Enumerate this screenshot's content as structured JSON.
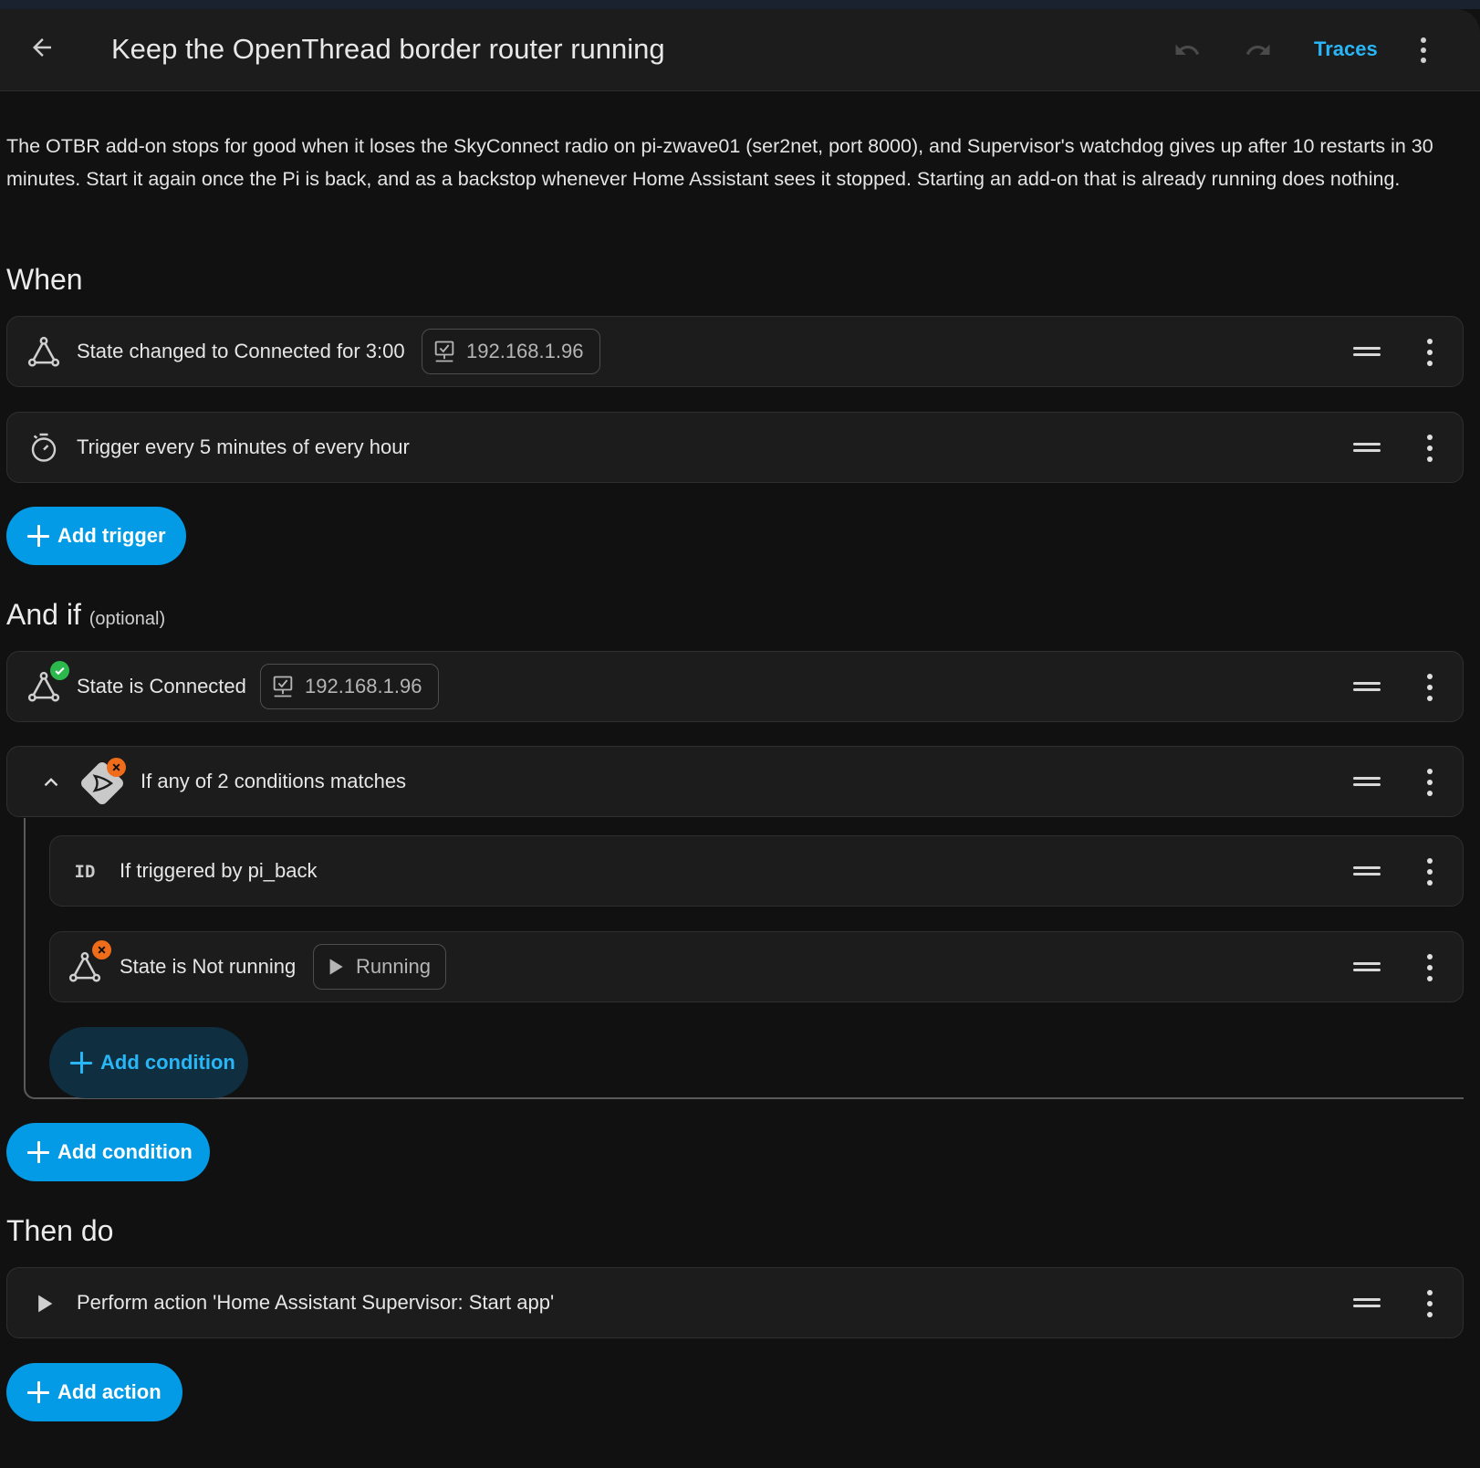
{
  "header": {
    "title": "Keep the OpenThread border router running",
    "traces_label": "Traces"
  },
  "description": "The OTBR add-on stops for good when it loses the SkyConnect radio on pi-zwave01 (ser2net, port 8000), and Supervisor's watchdog gives up after 10 restarts in 30 minutes. Start it again once the Pi is back, and as a backstop whenever Home Assistant sees it stopped. Starting an add-on that is already running does nothing.",
  "when": {
    "title": "When",
    "triggers": [
      {
        "label": "State changed to Connected for 3:00",
        "icon": "state-icon",
        "chip": "192.168.1.96",
        "chip_icon": "network-monitor-icon"
      },
      {
        "label": "Trigger every 5 minutes of every hour",
        "icon": "timer-icon"
      }
    ],
    "add_label": "Add trigger"
  },
  "and_if": {
    "title": "And if",
    "optional": "(optional)",
    "conditions": [
      {
        "label": "State is Connected",
        "icon": "state-icon",
        "badge": "check",
        "chip": "192.168.1.96",
        "chip_icon": "network-monitor-icon"
      },
      {
        "label": "If any of 2 conditions matches",
        "icon": "or-gate-icon",
        "badge": "error",
        "expanded": true,
        "children": [
          {
            "label": "If triggered by pi_back",
            "icon": "id-icon"
          },
          {
            "label": "State is Not running",
            "icon": "state-icon",
            "badge": "error",
            "chip": "Running",
            "chip_icon": "play-icon"
          }
        ],
        "add_label": "Add condition"
      }
    ],
    "add_label": "Add condition"
  },
  "then_do": {
    "title": "Then do",
    "actions": [
      {
        "label": "Perform action 'Home Assistant Supervisor: Start app'",
        "icon": "play-icon"
      }
    ],
    "add_label": "Add action"
  },
  "colors": {
    "accent": "#039be5",
    "accent_text": "#29b6f6",
    "background": "#111111",
    "card": "#1c1c1c",
    "ok_badge": "#2db84d",
    "error_badge": "#ef6c1a"
  }
}
